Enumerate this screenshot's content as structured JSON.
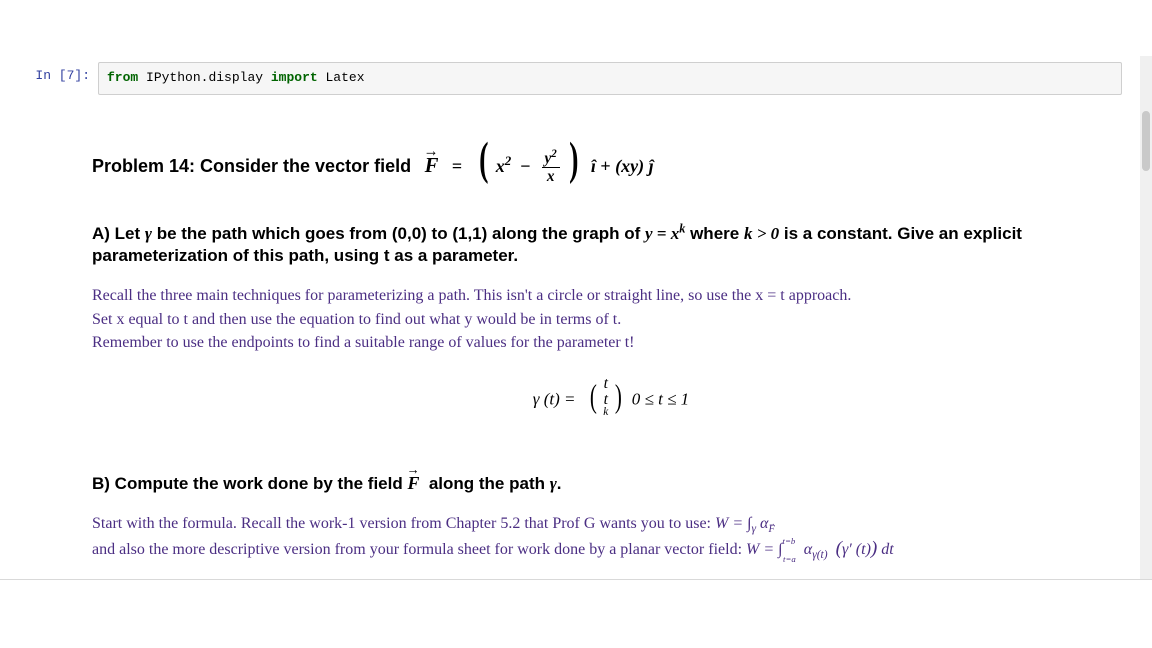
{
  "cell": {
    "prompt": "In [7]:",
    "code_kw_from": "from",
    "code_mod": "IPython.display",
    "code_kw_import": "import",
    "code_name": "Latex"
  },
  "heading": {
    "prefix": "Problem 14: Consider the vector field",
    "F": "F",
    "eq": "=",
    "term1_a": "x",
    "term1_a_exp": "2",
    "minus": "−",
    "frac_num_base": "y",
    "frac_num_exp": "2",
    "frac_den": "x",
    "ihat": "î",
    "plus": "+",
    "xy_open": "(",
    "xy": "xy",
    "xy_close": ")",
    "jhat": "ĵ"
  },
  "partA": {
    "line1_a": "A) Let ",
    "gamma": "γ",
    "line1_b": " be the path which goes from (0,0) to (1,1) along the graph of ",
    "yeq": "y = x",
    "k": "k",
    "line1_c": " where ",
    "kcond": "k > 0",
    "line1_d": " is a constant. Give an explicit parameterization of this path, using t as a parameter.",
    "hint1": "Recall the three main techniques for parameterizing a path. This isn't a circle or straight line, so use the x = t approach.",
    "hint2": "Set x equal to t and then use the equation to find out what y would be in terms of t.",
    "hint3": "Remember to use the endpoints to find a suitable range of values for the parameter t!",
    "eq_left": "γ (t) =",
    "col_top": "t",
    "col_bot_base": "t",
    "col_bot_exp": "k",
    "range": "0 ≤ t ≤ 1"
  },
  "partB": {
    "line1_a": "B) Compute the work done by the field ",
    "F": "F",
    "line1_b": " along the path ",
    "gamma": "γ",
    "period": ".",
    "hintB1_a": "Start with the formula. Recall the work-1 version from Chapter 5.2 that Prof G wants you to use:  ",
    "work1": "W = ∫",
    "work1_sub": "γ",
    "work1_alpha": "α",
    "work1_Fsub": "F",
    "hintB2_a": "and also the more descriptive version from your formula sheet for work done by a planar vector field:  ",
    "work2": "W = ∫",
    "bound_top": "t=b",
    "bound_bot": "t=a",
    "alpha2": "α",
    "gamt": "γ(t)",
    "inner_open": "(",
    "gp": "γ′ (t)",
    "inner_close": ")",
    "dt": " dt"
  }
}
